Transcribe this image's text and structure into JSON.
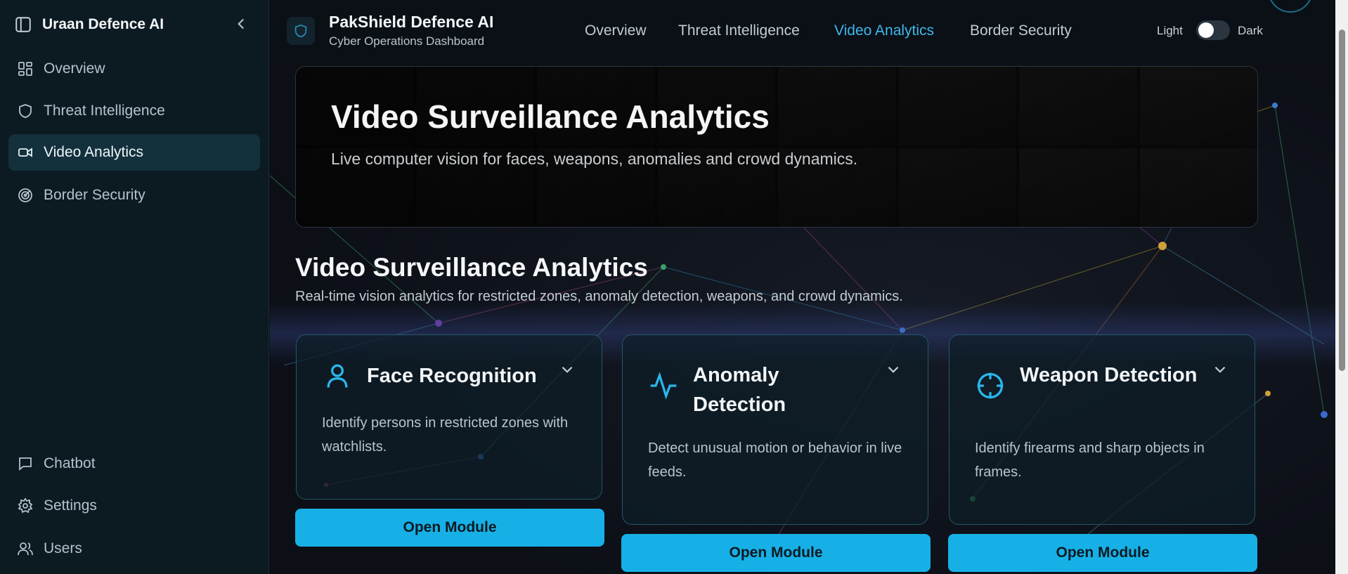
{
  "sidebar": {
    "app_title": "Uraan Defence AI",
    "items": [
      {
        "label": "Overview",
        "icon": "dashboard-icon"
      },
      {
        "label": "Threat Intelligence",
        "icon": "shield-icon"
      },
      {
        "label": "Video Analytics",
        "icon": "video-camera-icon",
        "active": true
      },
      {
        "label": "Border Security",
        "icon": "radar-icon"
      }
    ],
    "bottom_items": [
      {
        "label": "Chatbot",
        "icon": "chat-icon"
      },
      {
        "label": "Settings",
        "icon": "gear-icon"
      },
      {
        "label": "Users",
        "icon": "users-icon"
      }
    ]
  },
  "header": {
    "title": "PakShield Defence AI",
    "subtitle": "Cyber Operations Dashboard",
    "nav": [
      "Overview",
      "Threat Intelligence",
      "Video Analytics",
      "Border Security"
    ],
    "active_nav": "Video Analytics",
    "theme_light_label": "Light",
    "theme_dark_label": "Dark"
  },
  "hero": {
    "title": "Video Surveillance Analytics",
    "subtitle": "Live computer vision for faces, weapons, anomalies and crowd dynamics."
  },
  "section": {
    "title": "Video Surveillance Analytics",
    "subtitle": "Real-time vision analytics for restricted zones, anomaly detection, weapons, and crowd dynamics."
  },
  "modules": [
    {
      "title": "Face Recognition",
      "description": "Identify persons in restricted zones with watchlists.",
      "button": "Open Module",
      "icon": "user-icon"
    },
    {
      "title": "Anomaly Detection",
      "description": "Detect unusual motion or behavior in live feeds.",
      "button": "Open Module",
      "icon": "activity-icon"
    },
    {
      "title": "Weapon Detection",
      "description": "Identify firearms and sharp objects in frames.",
      "button": "Open Module",
      "icon": "crosshair-icon"
    }
  ],
  "colors": {
    "accent": "#17b0e6",
    "active_nav": "#3fb8ea",
    "sidebar_bg": "#0c1a22",
    "active_item_bg": "#13313d"
  }
}
